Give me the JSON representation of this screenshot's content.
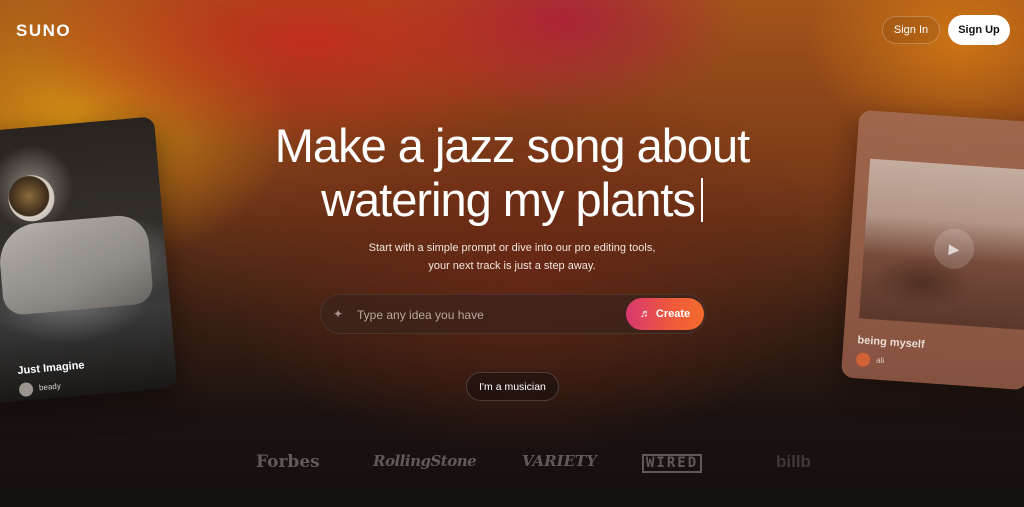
{
  "header": {
    "logo": "SUNO",
    "sign_in_label": "Sign In",
    "sign_up_label": "Sign Up"
  },
  "hero": {
    "headline_line1": "Make a jazz song about",
    "headline_line2": "watering my plants",
    "subtext": "Start with a simple prompt or dive into our pro editing tools, your next track is just a step away."
  },
  "prompt": {
    "placeholder": "Type any idea you have",
    "value": "",
    "create_label": "Create",
    "icon": "sparkle-icon",
    "create_icon": "music-note-icon"
  },
  "musician_label": "I'm a musician",
  "cards": [
    {
      "title": "Just Imagine",
      "user": "beady"
    },
    {
      "title": "being myself",
      "user": "ali"
    }
  ],
  "press": [
    "Forbes",
    "RollingStone",
    "VARIETY",
    "WIRED",
    "billb"
  ],
  "colors": {
    "create_gradient_start": "#d6386f",
    "create_gradient_end": "#f36b2e",
    "background_dark": "#141010"
  }
}
